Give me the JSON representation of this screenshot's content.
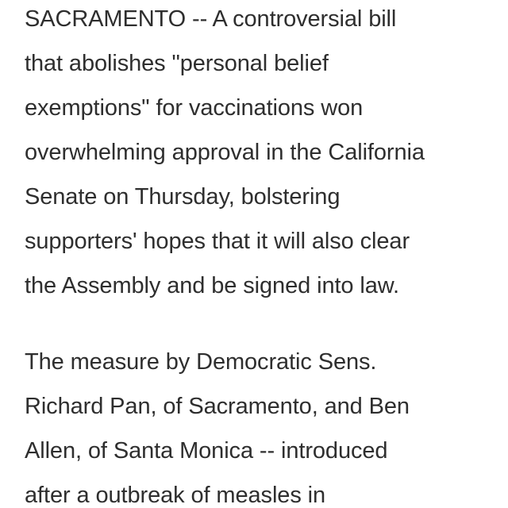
{
  "article": {
    "paragraphs": [
      {
        "lines": [
          "SACRAMENTO -- A controversial bill",
          "that abolishes \"personal belief",
          "exemptions\" for vaccinations won",
          "overwhelming approval in the California",
          "Senate on Thursday, bolstering",
          "supporters' hopes that it will also clear",
          "the Assembly and be signed into law."
        ]
      },
      {
        "lines": [
          "The measure by Democratic Sens.",
          "Richard Pan, of Sacramento, and Ben",
          "Allen, of Santa Monica -- introduced",
          "after a outbreak of measles in"
        ]
      }
    ]
  }
}
